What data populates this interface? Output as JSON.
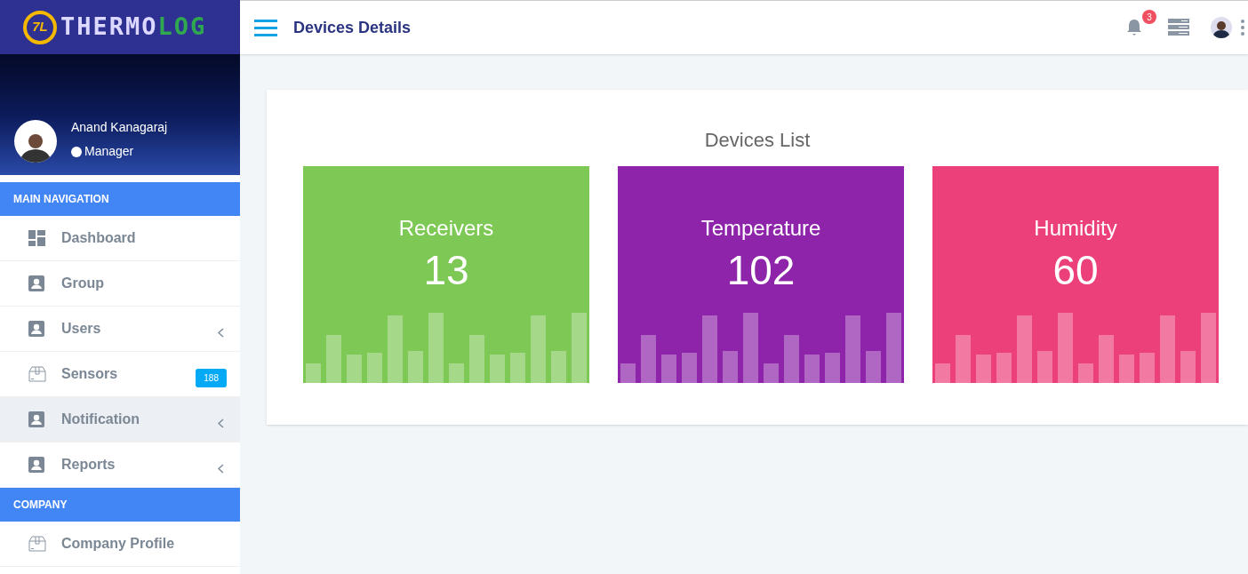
{
  "brand": {
    "text_main": "THERMO",
    "text_accent": "LOG",
    "monogram": "7L"
  },
  "header": {
    "title": "Devices Details",
    "notification_count": "3"
  },
  "profile": {
    "name": "Anand Kanagaraj",
    "role": "Manager"
  },
  "sidebar": {
    "sections": [
      {
        "title": "MAIN NAVIGATION",
        "items": [
          {
            "label": "Dashboard",
            "kind": "dashboard",
            "expandable": false,
            "selected": false
          },
          {
            "label": "Group",
            "kind": "person",
            "expandable": false,
            "selected": false
          },
          {
            "label": "Users",
            "kind": "person",
            "expandable": true,
            "selected": false
          },
          {
            "label": "Sensors",
            "kind": "box",
            "expandable": false,
            "selected": false,
            "badge": "188"
          },
          {
            "label": "Notification",
            "kind": "person",
            "expandable": true,
            "selected": true
          },
          {
            "label": "Reports",
            "kind": "person",
            "expandable": true,
            "selected": false
          }
        ]
      },
      {
        "title": "COMPANY",
        "items": [
          {
            "label": "Company Profile",
            "kind": "box",
            "expandable": false,
            "selected": false
          }
        ]
      }
    ]
  },
  "panel": {
    "title": "Devices List",
    "tiles": [
      {
        "label": "Receivers",
        "count": "13",
        "color": "#7ec855"
      },
      {
        "label": "Temperature",
        "count": "102",
        "color": "#8e24aa"
      },
      {
        "label": "Humidity",
        "count": "60",
        "color": "#ec407a"
      }
    ]
  }
}
